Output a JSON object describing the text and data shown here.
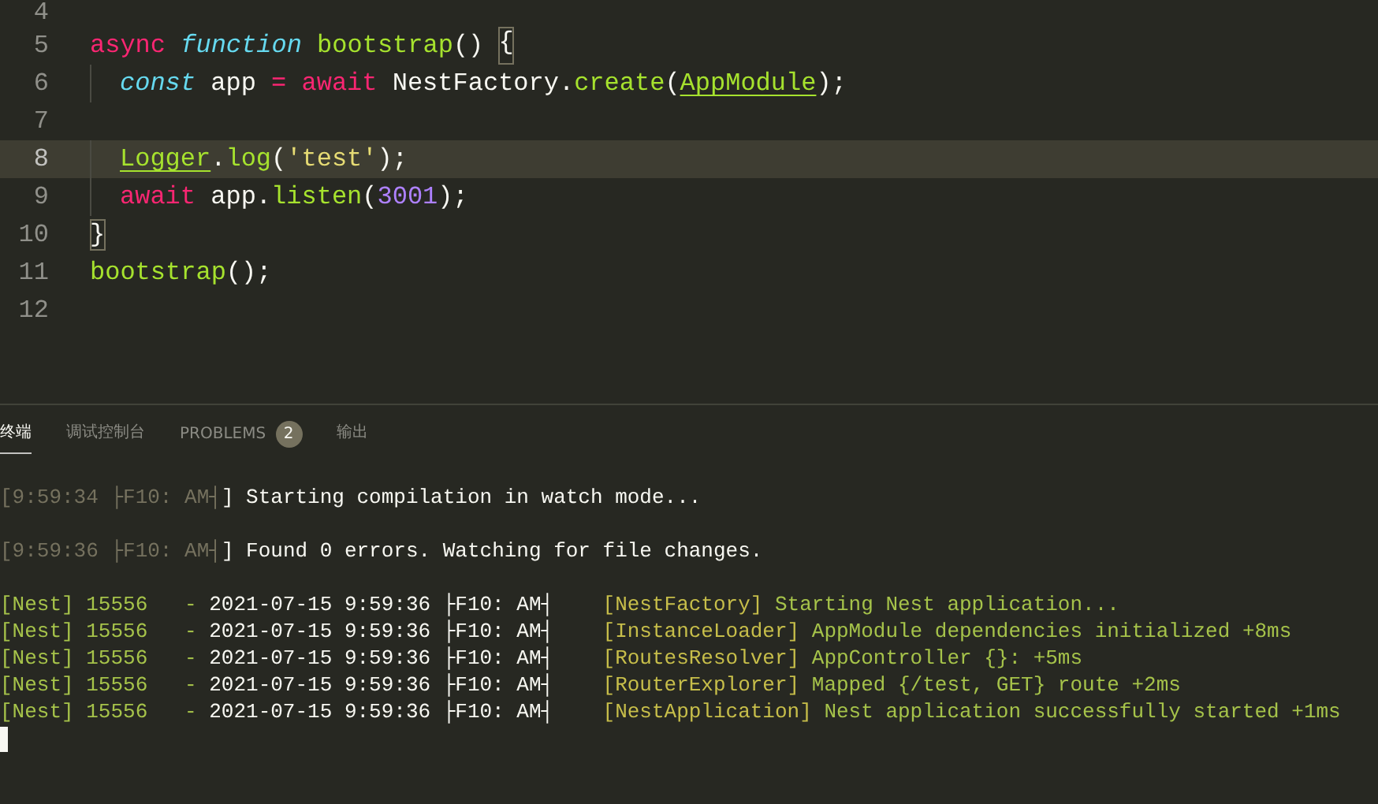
{
  "editor": {
    "lines": [
      {
        "number": "4",
        "current": false
      },
      {
        "number": "5",
        "current": false,
        "indented": false,
        "tokens": [
          {
            "kind": "keyword",
            "text": "async"
          },
          {
            "kind": "storage",
            "text": " function"
          },
          {
            "kind": "function",
            "text": " bootstrap"
          },
          {
            "kind": "plain",
            "text": "() "
          },
          {
            "kind": "bracket",
            "text": "{"
          }
        ]
      },
      {
        "number": "6",
        "current": false,
        "indented": true,
        "tokens": [
          {
            "kind": "storage",
            "text": "const"
          },
          {
            "kind": "plain",
            "text": " app "
          },
          {
            "kind": "keyword",
            "text": "="
          },
          {
            "kind": "keyword",
            "text": " await"
          },
          {
            "kind": "plain",
            "text": " NestFactory."
          },
          {
            "kind": "function",
            "text": "create"
          },
          {
            "kind": "plain",
            "text": "("
          },
          {
            "kind": "class",
            "text": "AppModule"
          },
          {
            "kind": "plain",
            "text": ");"
          }
        ]
      },
      {
        "number": "7",
        "current": false
      },
      {
        "number": "8",
        "current": true,
        "indented": true,
        "tokens": [
          {
            "kind": "class",
            "text": "Logger"
          },
          {
            "kind": "plain",
            "text": "."
          },
          {
            "kind": "function",
            "text": "log"
          },
          {
            "kind": "plain",
            "text": "("
          },
          {
            "kind": "string",
            "text": "'test'"
          },
          {
            "kind": "plain",
            "text": ");"
          }
        ]
      },
      {
        "number": "9",
        "current": false,
        "indented": true,
        "tokens": [
          {
            "kind": "keyword",
            "text": "await"
          },
          {
            "kind": "plain",
            "text": " app."
          },
          {
            "kind": "function",
            "text": "listen"
          },
          {
            "kind": "plain",
            "text": "("
          },
          {
            "kind": "number",
            "text": "3001"
          },
          {
            "kind": "plain",
            "text": ");"
          }
        ]
      },
      {
        "number": "10",
        "current": false,
        "indented": false,
        "tokens": [
          {
            "kind": "bracket",
            "text": "}"
          }
        ]
      },
      {
        "number": "11",
        "current": false,
        "indented": false,
        "tokens": [
          {
            "kind": "function",
            "text": "bootstrap"
          },
          {
            "kind": "plain",
            "text": "();"
          }
        ]
      },
      {
        "number": "12",
        "current": false
      }
    ]
  },
  "panel": {
    "tabs": [
      {
        "label": "终端",
        "selected": true
      },
      {
        "label": "调试控制台",
        "selected": false
      },
      {
        "label": "PROBLEMS",
        "selected": false,
        "badge": "2"
      },
      {
        "label": "输出",
        "selected": false
      }
    ],
    "terminal": [
      {
        "kind": "status",
        "segments": [
          {
            "kind": "dim",
            "text": "[9:59:34 ├F10: AM┤"
          },
          {
            "kind": "plain",
            "text": "] Starting compilation in watch mode..."
          }
        ]
      },
      {
        "kind": "status",
        "segments": [
          {
            "kind": "dim",
            "text": "[9:59:36 ├F10: AM┤"
          },
          {
            "kind": "plain",
            "text": "] Found 0 errors. Watching for file changes."
          }
        ]
      },
      {
        "segments": [
          {
            "kind": "green",
            "text": "[Nest] 15556   - "
          },
          {
            "kind": "plain",
            "text": "2021-07-15 9:59:36 ├F10: AM┤    "
          },
          {
            "kind": "yellow",
            "text": "[NestFactory]"
          },
          {
            "kind": "green",
            "text": " Starting Nest application..."
          }
        ]
      },
      {
        "segments": [
          {
            "kind": "green",
            "text": "[Nest] 15556   - "
          },
          {
            "kind": "plain",
            "text": "2021-07-15 9:59:36 ├F10: AM┤    "
          },
          {
            "kind": "yellow",
            "text": "[InstanceLoader]"
          },
          {
            "kind": "green",
            "text": " AppModule dependencies initialized +8ms"
          }
        ]
      },
      {
        "segments": [
          {
            "kind": "green",
            "text": "[Nest] 15556   - "
          },
          {
            "kind": "plain",
            "text": "2021-07-15 9:59:36 ├F10: AM┤    "
          },
          {
            "kind": "yellow",
            "text": "[RoutesResolver]"
          },
          {
            "kind": "green",
            "text": " AppController {}: +5ms"
          }
        ]
      },
      {
        "segments": [
          {
            "kind": "green",
            "text": "[Nest] 15556   - "
          },
          {
            "kind": "plain",
            "text": "2021-07-15 9:59:36 ├F10: AM┤    "
          },
          {
            "kind": "yellow",
            "text": "[RouterExplorer]"
          },
          {
            "kind": "green",
            "text": " Mapped {/test, GET} route +2ms"
          }
        ]
      },
      {
        "segments": [
          {
            "kind": "green",
            "text": "[Nest] 15556   - "
          },
          {
            "kind": "plain",
            "text": "2021-07-15 9:59:36 ├F10: AM┤    "
          },
          {
            "kind": "yellow",
            "text": "[NestApplication]"
          },
          {
            "kind": "green",
            "text": " Nest application successfully started +1ms"
          }
        ]
      }
    ]
  }
}
